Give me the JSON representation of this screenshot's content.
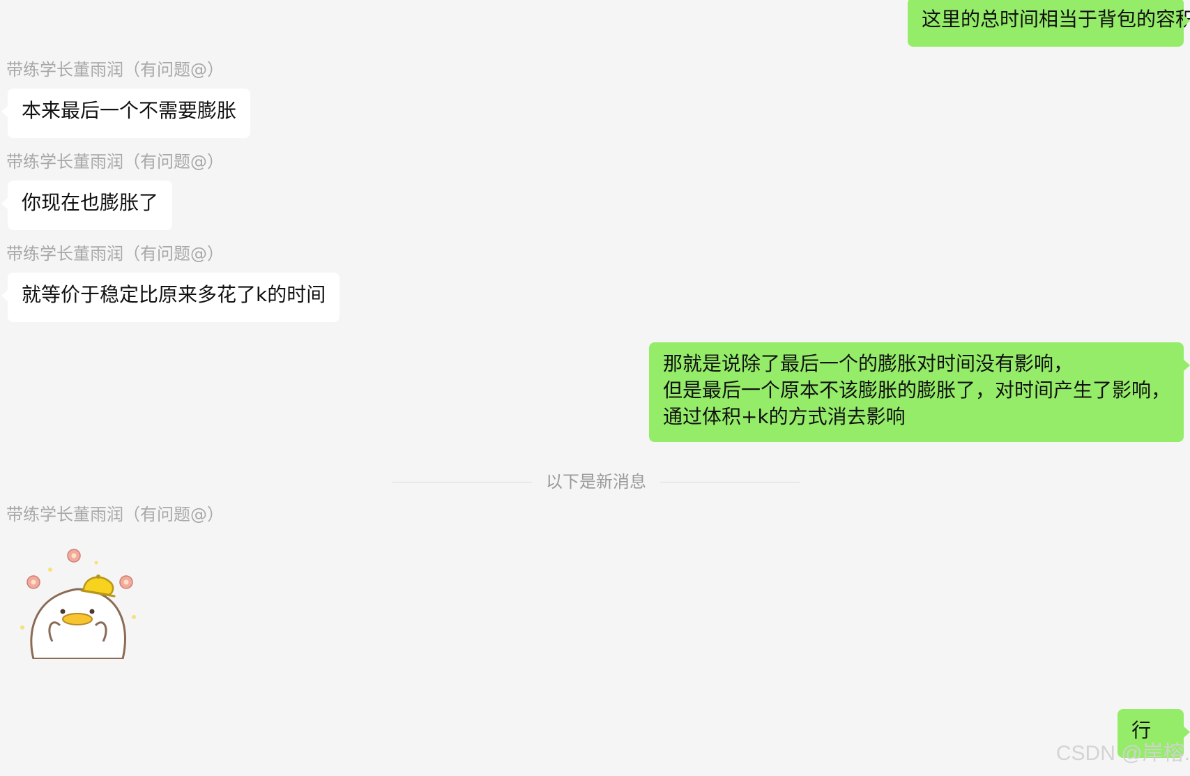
{
  "messages": [
    {
      "direction": "out",
      "lines": [
        "这里的总时间相当于背包的容积"
      ]
    },
    {
      "direction": "in",
      "sender": "带练学长董雨润（有问题@）",
      "lines": [
        "本来最后一个不需要膨胀"
      ]
    },
    {
      "direction": "in",
      "sender": "带练学长董雨润（有问题@）",
      "lines": [
        "你现在也膨胀了"
      ]
    },
    {
      "direction": "in",
      "sender": "带练学长董雨润（有问题@）",
      "lines": [
        "就等价于稳定比原来多花了k的时间"
      ]
    },
    {
      "direction": "out",
      "lines": [
        "那就是说除了最后一个的膨胀对时间没有影响，",
        "但是最后一个原本不该膨胀的膨胀了，对时间产生了影响，",
        "通过体积+k的方式消去影响"
      ]
    },
    {
      "direction": "in",
      "sender": "带练学长董雨润（有问题@）",
      "sticker": "duck-sticker"
    },
    {
      "direction": "out",
      "lines": [
        "行"
      ]
    }
  ],
  "divider": {
    "label": "以下是新消息"
  },
  "watermark": "CSDN @岸榕.",
  "colors": {
    "background": "#f5f5f5",
    "incoming_bubble": "#ffffff",
    "outgoing_bubble": "#95ec69",
    "sender_name": "#a8a8a8"
  }
}
